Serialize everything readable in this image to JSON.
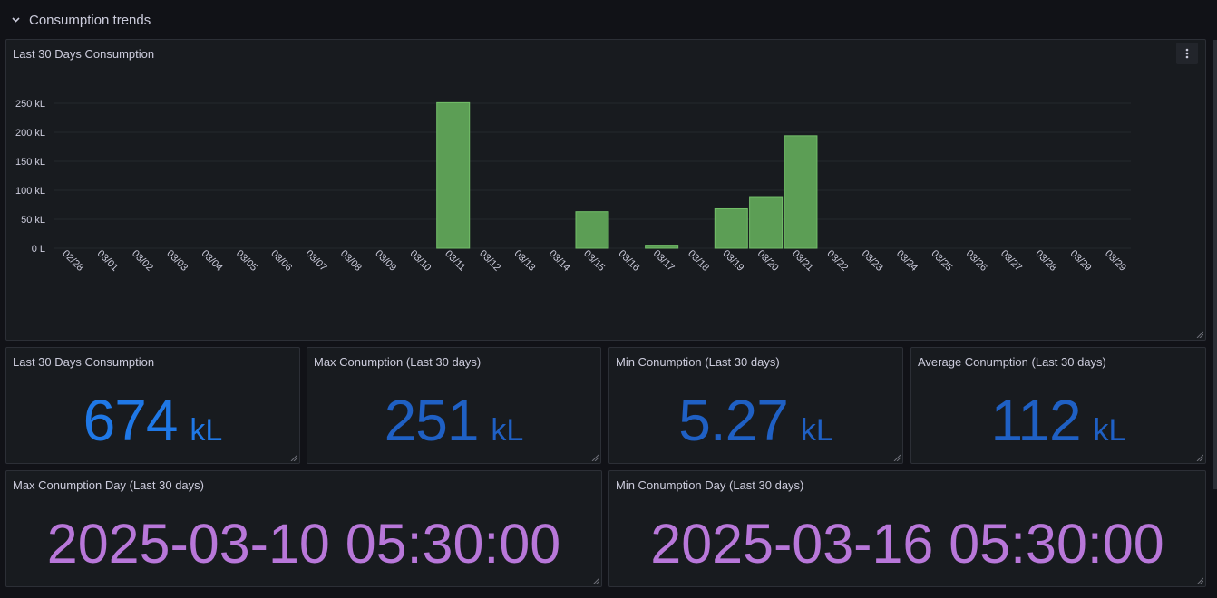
{
  "row": {
    "title": "Consumption trends"
  },
  "chart_panel": {
    "title": "Last 30 Days Consumption"
  },
  "chart_data": {
    "type": "bar",
    "categories": [
      "02/28",
      "03/01",
      "03/02",
      "03/03",
      "03/04",
      "03/05",
      "03/06",
      "03/07",
      "03/08",
      "03/09",
      "03/10",
      "03/11",
      "03/12",
      "03/13",
      "03/14",
      "03/15",
      "03/16",
      "03/17",
      "03/18",
      "03/19",
      "03/20",
      "03/21",
      "03/22",
      "03/23",
      "03/24",
      "03/25",
      "03/26",
      "03/27",
      "03/28",
      "03/29",
      "03/29"
    ],
    "values": [
      0,
      0,
      0,
      0,
      0,
      0,
      0,
      0,
      0,
      0,
      0,
      251,
      0,
      0,
      0,
      63,
      0,
      5.27,
      0,
      68,
      89,
      194,
      0,
      0,
      0,
      0,
      0,
      0,
      0,
      0,
      0
    ],
    "yticks": [
      "0 L",
      "50 kL",
      "100 kL",
      "150 kL",
      "200 kL",
      "250 kL"
    ],
    "ytick_values": [
      0,
      50,
      100,
      150,
      200,
      250
    ],
    "ylim": [
      0,
      260
    ],
    "color": "#73bf69",
    "grid": true,
    "legend": "none"
  },
  "stats": [
    {
      "title": "Last 30 Days Consumption",
      "value": "674",
      "unit": "kL",
      "color": "#1f78e6"
    },
    {
      "title": "Max Conumption (Last 30 days)",
      "value": "251",
      "unit": "kL",
      "color": "#1f60c4"
    },
    {
      "title": "Min Conumption (Last 30 days)",
      "value": "5.27",
      "unit": "kL",
      "color": "#1f60c4"
    },
    {
      "title": "Average Conumption (Last 30 days)",
      "value": "112",
      "unit": "kL",
      "color": "#1f60c4"
    }
  ],
  "dates": [
    {
      "title": "Max Conumption Day (Last 30 days)",
      "value": "2025-03-10 05:30:00",
      "color": "#b877d9"
    },
    {
      "title": "Min Conumption Day (Last 30 days)",
      "value": "2025-03-16 05:30:00",
      "color": "#b877d9"
    }
  ],
  "icons": {
    "row_toggle": "chevron-down-icon",
    "panel_menu": "kebab-menu-icon",
    "resize": "resize-handle-icon"
  }
}
